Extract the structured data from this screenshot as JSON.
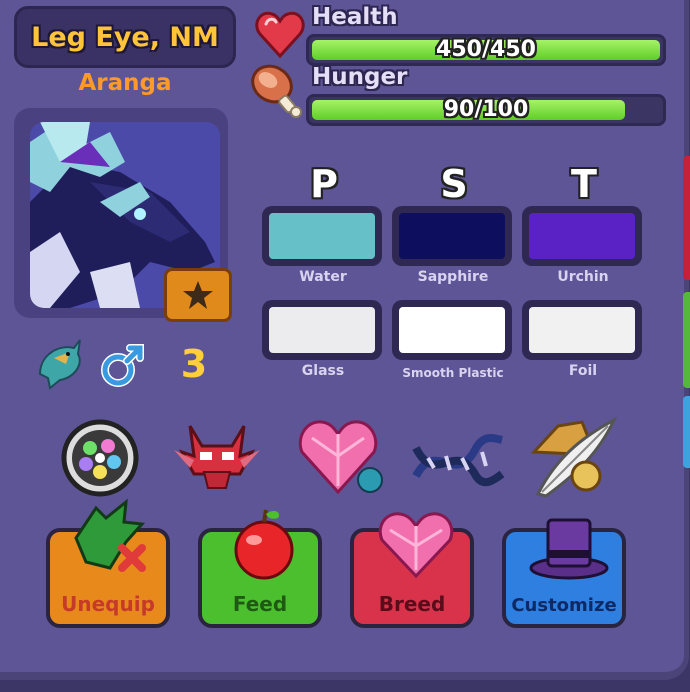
{
  "pet": {
    "name": "Leg Eye, NM",
    "species": "Aranga",
    "level": "3",
    "gender_icon": "male-symbol-icon",
    "type_icon": "dragon-badge-icon"
  },
  "stats": {
    "health": {
      "label": "Health",
      "text": "450/450",
      "fraction": 1.0,
      "icon": "heart-icon"
    },
    "hunger": {
      "label": "Hunger",
      "text": "90/100",
      "fraction": 0.9,
      "icon": "meat-leg-icon"
    }
  },
  "traits": {
    "headers": [
      "P",
      "S",
      "T"
    ],
    "row1": [
      {
        "name": "Water",
        "color": "#65c1c7"
      },
      {
        "name": "Sapphire",
        "color": "#0e0e5e"
      },
      {
        "name": "Urchin",
        "color": "#5a22c4"
      }
    ],
    "row2": [
      {
        "name": "Glass",
        "color": "#ececee"
      },
      {
        "name": "Smooth Plastic",
        "color": "#ffffff"
      },
      {
        "name": "Foil",
        "color": "#f1f1f1"
      }
    ]
  },
  "accessories": [
    "rainbow-orb-icon",
    "horned-mask-icon",
    "gem-heart-icon",
    "dna-strand-icon",
    "feather-hat-icon"
  ],
  "actions": {
    "unequip": "Unequip",
    "feed": "Feed",
    "breed": "Breed",
    "customize": "Customize"
  },
  "colors": {
    "unequip": "#e8891c",
    "feed": "#4cbf2e",
    "breed": "#d8334a",
    "customize": "#2f7fe0"
  }
}
